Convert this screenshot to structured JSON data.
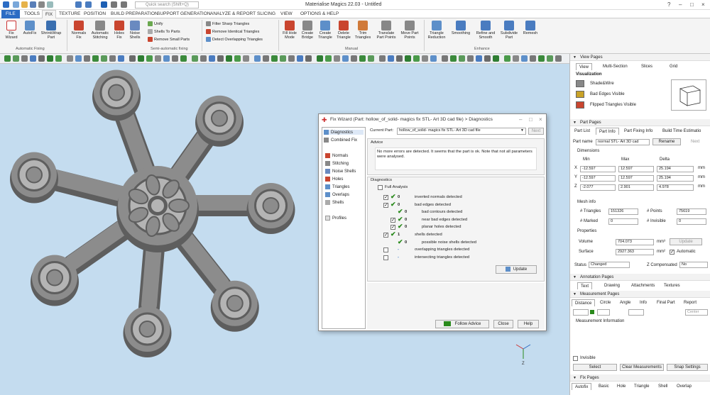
{
  "app": {
    "title": "Materialise Magics 22.03 - Untitled",
    "search_placeholder": "Quick search (Shift+Q)"
  },
  "menu": [
    "FILE",
    "TOOLS",
    "FIX",
    "TEXTURE",
    "POSITION",
    "BUILD PREPARATION",
    "SUPPORT GENERATION",
    "ANALYZE & REPORT",
    "SLICING",
    "VIEW",
    "OPTIONS & HELP"
  ],
  "ribbon": {
    "fix_wizard": "Fix\nWizard",
    "autofix": "AutoFix",
    "shrinkwrap": "ShrinkWrap\nPart",
    "group_auto": "Automatic Fixing",
    "normals_fix": "Normals\nFix",
    "auto_stitch": "Automatic\nStitching",
    "holes_fix": "Holes\nFix",
    "noise_shells": "Noise\nShells",
    "unify": "Unify",
    "shells_to_parts": "Shells To Parts",
    "remove_small": "Remove Small Parts",
    "group_semi": "Semi-automatic fixing",
    "filter_sharp": "Filter Sharp Triangles",
    "remove_identical": "Remove Identical Triangles",
    "detect_overlap": "Detect Overlapping Triangles",
    "fill_hole": "Fill Hole\nMode",
    "create_bridge": "Create\nBridge",
    "create_tri": "Create\nTriangle",
    "delete_tri": "Delete\nTriangle",
    "trim_tri": "Trim\nTriangles",
    "translate_pts": "Translate\nPart Points",
    "move_pts": "Move Part\nPoints",
    "group_manual": "Manual",
    "tri_reduction": "Triangle\nReduction",
    "smoothing": "Smoothing",
    "refine_smooth": "Refine and\nSmooth",
    "subdivide": "Subdivide\nPart",
    "remesh": "Remesh",
    "group_enhance": "Enhance"
  },
  "view_pages": {
    "title": "View Pages",
    "tabs": [
      "View",
      "Multi-Section",
      "Slices",
      "Grid"
    ],
    "visualization": "Visualization",
    "shade": "Shade&Wire",
    "bad_edges": "Bad Edges Visible",
    "flipped": "Flipped Triangles Visible"
  },
  "part_pages": {
    "title": "Part Pages",
    "tabs": [
      "Part List",
      "Part Info",
      "Part Fixing Info",
      "Build Time Estimatio"
    ],
    "part_name_label": "Part name",
    "part_name": "normal STL- Art 3D cad",
    "rename": "Rename",
    "next": "Next",
    "dimensions": "Dimensions",
    "min": "Min",
    "max": "Max",
    "delta": "Delta",
    "rows": [
      {
        "axis": "X",
        "min": "-12.597",
        "max": "12.597",
        "delta": "25.194",
        "unit": "mm"
      },
      {
        "axis": "Y",
        "min": "-12.597",
        "max": "12.597",
        "delta": "25.194",
        "unit": "mm"
      },
      {
        "axis": "Z",
        "min": "-2.077",
        "max": "2.901",
        "delta": "4.978",
        "unit": "mm"
      }
    ],
    "mesh_info": "Mesh info",
    "triangles_label": "# Triangles",
    "triangles": "151326",
    "points_label": "# Points",
    "points": "75619",
    "marked_label": "# Marked",
    "marked": "0",
    "invisible_label": "# Invisible",
    "invisible": "0",
    "properties": "Properties",
    "volume_label": "Volume",
    "volume": "704.073",
    "volume_unit": "mm³",
    "update": "Update",
    "surface_label": "Surface",
    "surface": "2927.363",
    "surface_unit": "mm²",
    "automatic": "Automatic",
    "status_label": "Status",
    "status": "Changed",
    "zcomp_label": "Z Compensated",
    "zcomp": "No"
  },
  "annotation_pages": {
    "title": "Annotation Pages",
    "tabs": [
      "Text",
      "Drawing",
      "Attachments",
      "Textures"
    ]
  },
  "measurement_pages": {
    "title": "Measurement Pages",
    "tabs": [
      "Distance",
      "Circle",
      "Angle",
      "Info",
      "Final Part",
      "Report"
    ],
    "center": "Center",
    "info_title": "Measurement Information",
    "invisible": "Invisible",
    "select": "Select",
    "clear": "Clear Measurements",
    "snap": "Snap Settings"
  },
  "fix_pages": {
    "title": "Fix Pages",
    "tabs": [
      "Autofix",
      "Basic",
      "Hole",
      "Triangle",
      "Shell",
      "Overlap"
    ]
  },
  "dialog": {
    "title": "Fix Wizard (Part: hollow_of_solid- magics fix STL- Art 3D cad file) > Diagnostics",
    "nav": [
      "Diagnostics",
      "Combined Fix",
      "Normals",
      "Stitching",
      "Noise Shells",
      "Holes",
      "Triangles",
      "Overlaps",
      "Shells",
      "Profiles"
    ],
    "current_part_label": "Current Part:",
    "current_part": "hollow_of_solid- magics fix STL- Art 3D cad file",
    "next": "Next",
    "advice_title": "Advice",
    "advice": "No more errors are detected. It seems that the part is ok. Note that not all parameters were analysed.",
    "diag_title": "Diagnostics",
    "full_analysis": "Full Analysis",
    "items": [
      {
        "count": "0",
        "label": "inverted normals detected"
      },
      {
        "count": "0",
        "label": "bad edges detected"
      },
      {
        "count": "0",
        "label": "bad contours detected"
      },
      {
        "count": "0",
        "label": "near bad edges detected"
      },
      {
        "count": "0",
        "label": "planar holes detected"
      },
      {
        "count": "1",
        "label": "shells detected"
      },
      {
        "count": "0",
        "label": "possible noise shells detected"
      },
      {
        "count": "-",
        "label": "overlapping triangles detected"
      },
      {
        "count": "-",
        "label": "intersecting triangles detected"
      }
    ],
    "update": "Update",
    "follow": "Follow Advice",
    "close": "Close",
    "help": "Help"
  },
  "axis": {
    "x": "X",
    "y": "Y",
    "z": "Z"
  },
  "colors": {
    "accent": "#2b6cc4",
    "check": "#2a8a1c",
    "model": "#8c8c8c",
    "model_dark": "#5e5e5e",
    "model_light": "#b4b4b4"
  }
}
